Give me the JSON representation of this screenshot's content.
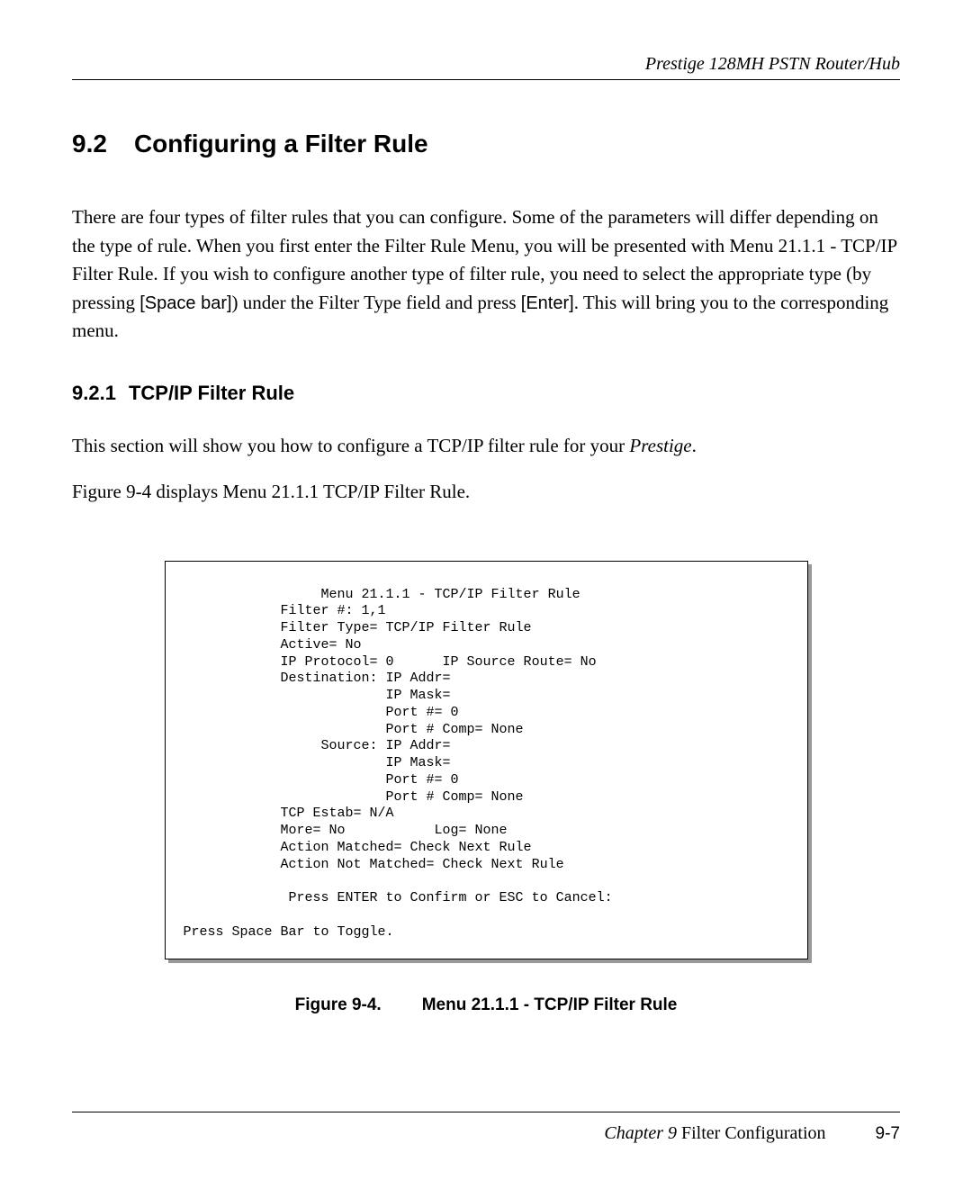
{
  "header": {
    "product_name": "Prestige 128MH    PSTN Router/Hub"
  },
  "section": {
    "number": "9.2",
    "title": "Configuring a Filter Rule"
  },
  "paragraph1_part1": "There are four types of filter rules that you can configure. Some of the parameters will differ depending on the type of rule. When you first enter the Filter Rule Menu, you will be presented with Menu 21.1.1 - TCP/IP Filter Rule. If you wish to configure another type of filter rule, you need to select the appropriate type (by pressing ",
  "paragraph1_spacebar": "[Space bar]",
  "paragraph1_part2": ") under the Filter Type field and press ",
  "paragraph1_enter": "[Enter]",
  "paragraph1_part3": ". This will bring you to the corresponding menu.",
  "subsection": {
    "number": "9.2.1",
    "title": "TCP/IP Filter Rule"
  },
  "subsection_intro_part1": "This section will show you how to configure a TCP/IP filter rule for your ",
  "subsection_intro_italic": "Prestige",
  "subsection_intro_part2": ".",
  "figure_ref": "Figure 9-4 displays Menu 21.1.1 TCP/IP Filter Rule.",
  "terminal": {
    "content": "                 Menu 21.1.1 - TCP/IP Filter Rule\n            Filter #: 1,1\n            Filter Type= TCP/IP Filter Rule\n            Active= No\n            IP Protocol= 0      IP Source Route= No\n            Destination: IP Addr=\n                         IP Mask=\n                         Port #= 0\n                         Port # Comp= None\n                 Source: IP Addr=\n                         IP Mask=\n                         Port #= 0\n                         Port # Comp= None\n            TCP Estab= N/A\n            More= No           Log= None\n            Action Matched= Check Next Rule\n            Action Not Matched= Check Next Rule\n\n             Press ENTER to Confirm or ESC to Cancel:\n\nPress Space Bar to Toggle."
  },
  "figure_caption": {
    "label": "Figure 9-4.",
    "title": "Menu 21.1.1 - TCP/IP Filter Rule"
  },
  "footer": {
    "chapter_label": "Chapter 9 ",
    "chapter_title": "Filter Configuration",
    "page": "9-7"
  }
}
